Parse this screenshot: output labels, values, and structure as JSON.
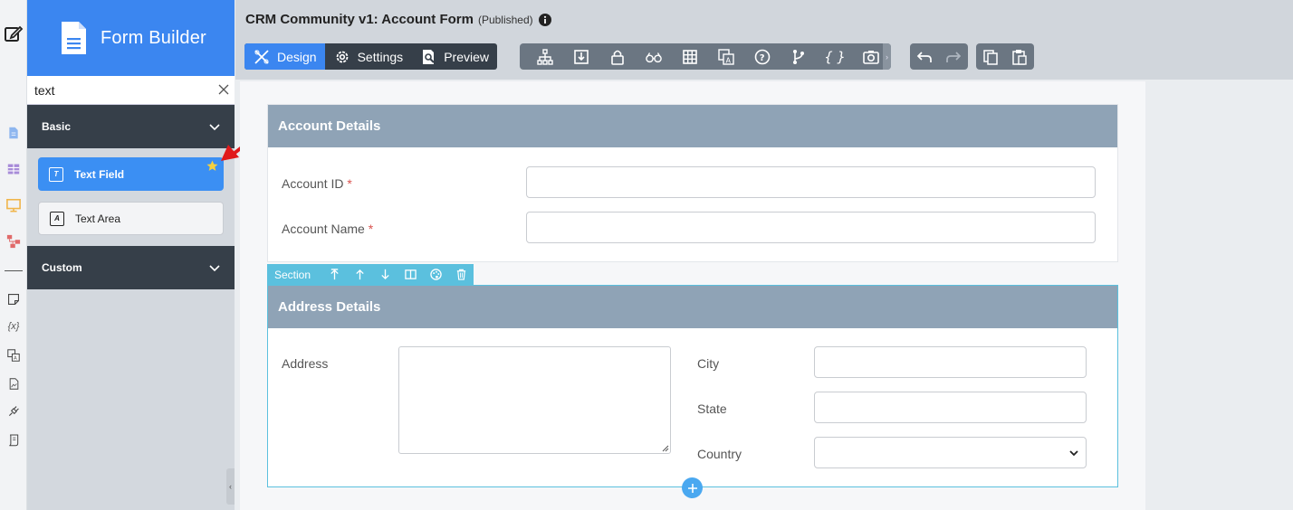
{
  "app": {
    "title": "Form Builder"
  },
  "search": {
    "value": "text",
    "placeholder": ""
  },
  "categories": [
    {
      "label": "Basic",
      "expanded": true
    },
    {
      "label": "Custom",
      "expanded": false
    }
  ],
  "components": [
    {
      "label": "Text Field",
      "active": true,
      "favorite": true
    },
    {
      "label": "Text Area",
      "active": false
    }
  ],
  "header": {
    "title": "CRM Community v1: Account Form",
    "status": "(Published)"
  },
  "modes": [
    {
      "label": "Design",
      "active": true
    },
    {
      "label": "Settings",
      "active": false
    },
    {
      "label": "Preview",
      "active": false
    }
  ],
  "toolbar_icons": [
    "sitemap-icon",
    "import-icon",
    "lock-icon",
    "glasses-icon",
    "grid-icon",
    "translate-icon",
    "help-icon",
    "branch-icon",
    "braces-icon",
    "camera-icon"
  ],
  "sections": [
    {
      "title": "Account Details",
      "fields": [
        {
          "label": "Account ID",
          "required": "*",
          "value": ""
        },
        {
          "label": "Account Name",
          "required": "*",
          "value": ""
        }
      ]
    },
    {
      "title": "Address Details",
      "fields": [
        {
          "label": "Address",
          "value": ""
        },
        {
          "label": "City",
          "value": ""
        },
        {
          "label": "State",
          "value": ""
        },
        {
          "label": "Country",
          "value": ""
        }
      ]
    }
  ],
  "section_toolbar": {
    "label": "Section"
  },
  "colors": {
    "brand": "#3b86f0",
    "dark": "#363f49",
    "section_header": "#8fa3b6",
    "selection": "#5bc0de",
    "required": "#d9534f",
    "arrow": "#e0191b",
    "star": "#f4d03f"
  }
}
